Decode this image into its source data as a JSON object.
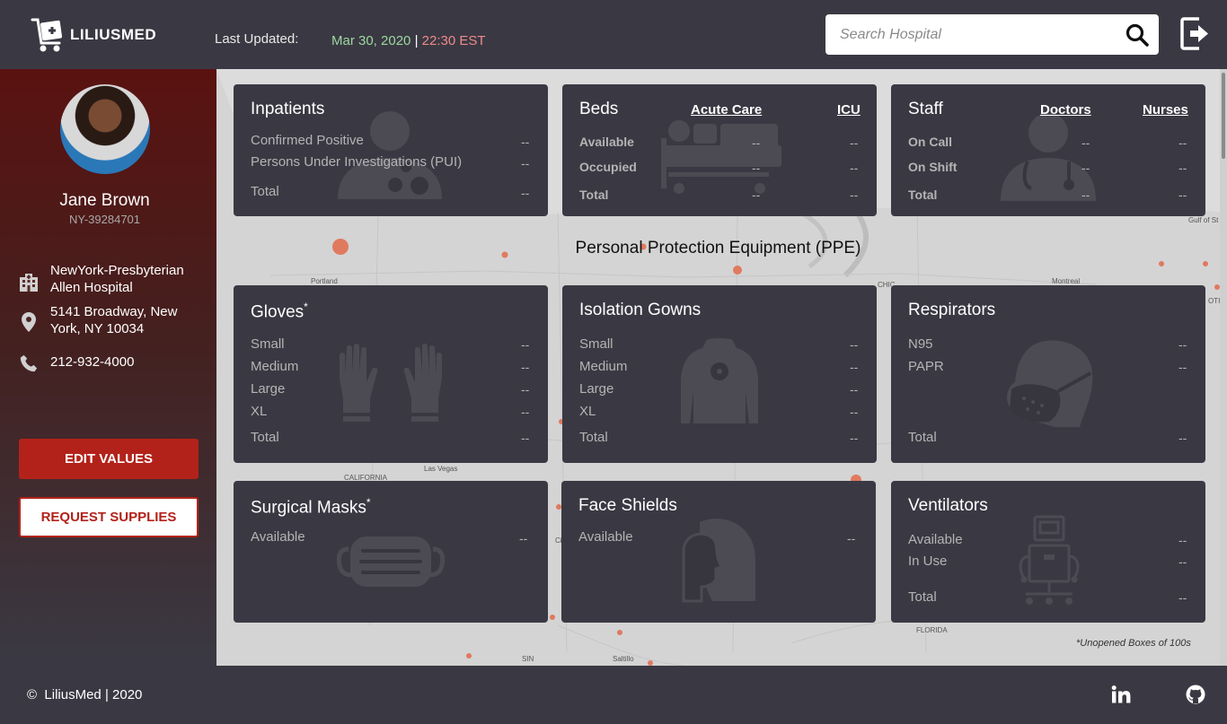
{
  "header": {
    "app_name": "LILIUSMED",
    "last_updated_label": "Last Updated:",
    "last_updated_date": "Mar 30, 2020",
    "separator": "|",
    "last_updated_time": "22:30 EST",
    "search_placeholder": "Search Hospital",
    "icons": [
      "hospital-cart-logo-icon",
      "search-icon",
      "logout-icon"
    ]
  },
  "sidebar": {
    "user_name": "Jane Brown",
    "user_id": "NY-39284701",
    "hospital": "NewYork-Presbyterian Allen Hospital",
    "address": "5141 Broadway, New York, NY 10034",
    "phone": "212-932-4000",
    "edit_label": "EDIT VALUES",
    "request_label": "REQUEST SUPPLIES",
    "icons": [
      "building-icon",
      "location-pin-icon",
      "phone-icon"
    ]
  },
  "cards": {
    "inpatients": {
      "title": "Inpatients",
      "rows": [
        {
          "label": "Confirmed Positive",
          "value": "--"
        },
        {
          "label": "Persons Under Investigations (PUI)",
          "value": "--"
        },
        {
          "label": "Total",
          "value": "--"
        }
      ]
    },
    "beds": {
      "title": "Beds",
      "columns": [
        "Acute Care",
        "ICU"
      ],
      "rows": [
        {
          "label": "Available",
          "values": [
            "--",
            "--"
          ]
        },
        {
          "label": "Occupied",
          "values": [
            "--",
            "--"
          ]
        },
        {
          "label": "Total",
          "values": [
            "--",
            "--"
          ]
        }
      ]
    },
    "staff": {
      "title": "Staff",
      "columns": [
        "Doctors",
        "Nurses"
      ],
      "rows": [
        {
          "label": "On Call",
          "values": [
            "--",
            "--"
          ]
        },
        {
          "label": "On Shift",
          "values": [
            "--",
            "--"
          ]
        },
        {
          "label": "Total",
          "values": [
            "--",
            "--"
          ]
        }
      ]
    },
    "gloves": {
      "title": "Gloves",
      "asterisk": "*",
      "rows": [
        {
          "label": "Small",
          "value": "--"
        },
        {
          "label": "Medium",
          "value": "--"
        },
        {
          "label": "Large",
          "value": "--"
        },
        {
          "label": "XL",
          "value": "--"
        },
        {
          "label": "Total",
          "value": "--"
        }
      ]
    },
    "gowns": {
      "title": "Isolation Gowns",
      "rows": [
        {
          "label": "Small",
          "value": "--"
        },
        {
          "label": "Medium",
          "value": "--"
        },
        {
          "label": "Large",
          "value": "--"
        },
        {
          "label": "XL",
          "value": "--"
        },
        {
          "label": "Total",
          "value": "--"
        }
      ]
    },
    "respirators": {
      "title": "Respirators",
      "rows": [
        {
          "label": "N95",
          "value": "--"
        },
        {
          "label": "PAPR",
          "value": "--"
        },
        {
          "label": "Total",
          "value": "--"
        }
      ]
    },
    "masks": {
      "title": "Surgical Masks",
      "asterisk": "*",
      "rows": [
        {
          "label": "Available",
          "value": "--"
        }
      ]
    },
    "shields": {
      "title": "Face Shields",
      "rows": [
        {
          "label": "Available",
          "value": "--"
        }
      ]
    },
    "ventilators": {
      "title": "Ventilators",
      "rows": [
        {
          "label": "Available",
          "value": "--"
        },
        {
          "label": "In Use",
          "value": "--"
        },
        {
          "label": "Total",
          "value": "--"
        }
      ]
    }
  },
  "ppe_heading": "Personal Protection Equipment (PPE)",
  "footnote": "*Unopened Boxes of 100s",
  "map_labels": {
    "portland": "Portland",
    "montreal": "Montreal",
    "california": "CALIFORNIA",
    "las_vegas": "Las Vegas",
    "florida": "FLORIDA",
    "saltillo": "Saltillo",
    "gulf": "Gulf of St",
    "chic": "CHIC",
    "otia": "OTIA",
    "sin": "SIN",
    "ci": "Ci"
  },
  "footer": {
    "copyright_symbol": "©",
    "copyright": "LiliusMed",
    "separator": "|",
    "year": "2020",
    "icons": [
      "linkedin-icon",
      "github-icon"
    ]
  },
  "colors": {
    "background": "#3a3943",
    "accent_red": "#b3221a",
    "date_green": "#9fd6a1",
    "time_red": "#f08a8a",
    "map_dot": "#e07a5f"
  }
}
